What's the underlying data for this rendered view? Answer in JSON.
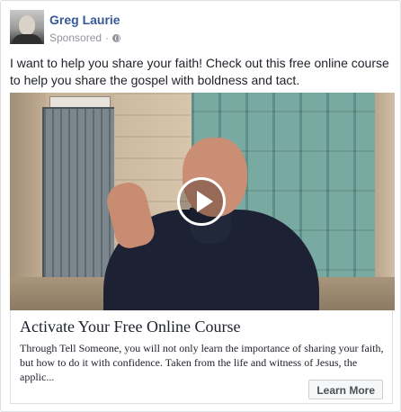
{
  "post": {
    "author": "Greg Laurie",
    "sponsored_label": "Sponsored",
    "separator": "·",
    "privacy_icon": "globe-icon",
    "message": "I want to help you share your faith! Check out this free online course to help you share the gospel with boldness and tact."
  },
  "media": {
    "play_icon": "play-icon"
  },
  "link": {
    "title": "Activate Your Free Online Course",
    "description": "Through Tell Someone, you will not only learn the importance of sharing your faith, but how to do it with confidence. Taken from the life and witness of Jesus, the applic...",
    "cta_label": "Learn More"
  },
  "colors": {
    "author_link": "#365899",
    "meta_text": "#90949c",
    "body_text": "#1d2129",
    "border": "#dddfe2"
  }
}
